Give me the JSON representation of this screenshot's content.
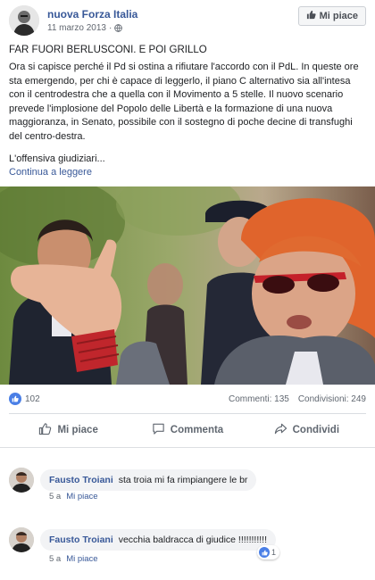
{
  "post": {
    "page_name": "nuova Forza Italia",
    "date": "11 marzo 2013",
    "date_separator": "·",
    "like_page_label": "Mi piace",
    "title": "FAR FUORI BERLUSCONI. E POI GRILLO",
    "body": "Ora si capisce perché il Pd si ostina a rifiutare l'accordo con il PdL. In queste ore sta emergendo, per chi è capace di leggerlo, il piano C alternativo sia all'intesa con il centrodestra che a quella con il Movimento a 5 stelle. Il nuovo scenario prevede l'implosione del Popolo delle Libertà e la formazione di una nuova maggioranza, in Senato, possibile con il sostegno di poche decine di transfughi del centro-destra.",
    "teaser": "L'offensiva giudiziari...",
    "read_more": "Continua a leggere",
    "stats": {
      "likes": "102",
      "comments": "Commenti: 135",
      "shares": "Condivisioni: 249"
    },
    "actions": {
      "like": "Mi piace",
      "comment": "Commenta",
      "share": "Condividi"
    }
  },
  "comments": [
    {
      "author": "Fausto Troiani",
      "text": "sta troia mi fa rimpiangere le br",
      "age": "5 a",
      "like_link": "Mi piace"
    },
    {
      "author": "Fausto Troiani",
      "text": "vecchia baldracca di giudice !!!!!!!!!!!",
      "age": "5 a",
      "like_link": "Mi piace",
      "reactions": "1"
    }
  ],
  "colors": {
    "link": "#385898",
    "like_blue": "#4a7fe6",
    "bubble_bg": "#f2f3f5"
  },
  "icons": {
    "globe": "globe-icon",
    "thumbs_up": "thumbs-up-icon",
    "comment": "comment-icon",
    "share": "share-icon"
  }
}
